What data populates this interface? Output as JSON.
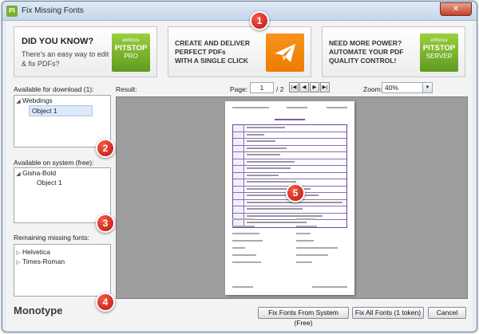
{
  "window": {
    "title": "Fix Missing Fonts",
    "app_icon_glyph": "PI",
    "close_glyph": "✕"
  },
  "banners": [
    {
      "headline": "DID YOU KNOW?",
      "text": "There's an easy way to edit & fix PDFs?",
      "logo": {
        "small": "enfocus",
        "big": "PITSTOP",
        "tag": "PRO"
      }
    },
    {
      "text_lines": [
        "CREATE AND DELIVER",
        "PERFECT PDFs",
        "WITH A SINGLE CLICK"
      ],
      "icon": "send-icon"
    },
    {
      "text_lines": [
        "NEED MORE POWER?",
        "AUTOMATE YOUR PDF",
        "QUALITY CONTROL!"
      ],
      "logo": {
        "small": "enfocus",
        "big": "PITSTOP",
        "tag": "SERVER"
      }
    }
  ],
  "markers": [
    "1",
    "2",
    "3",
    "4",
    "5"
  ],
  "download": {
    "label": "Available for download (1):",
    "font": "Webdings",
    "object": "Object 1"
  },
  "system": {
    "label": "Available on system (free):",
    "font": "Gisha-Bold",
    "object": "Object 1"
  },
  "missing": {
    "label": "Remaining missing fonts:",
    "fonts": [
      "Helvetica",
      "Times-Roman"
    ]
  },
  "result": {
    "label": "Result:"
  },
  "pager": {
    "label": "Page:",
    "current": "1",
    "total": "/ 2",
    "first": "|◀",
    "prev": "◀",
    "next": "▶",
    "last": "▶|"
  },
  "zoom": {
    "label": "Zoom:",
    "value": "40%",
    "arrow": "▼"
  },
  "brand": "Monotype",
  "buttons": {
    "fix_system": "Fix Fonts From System (Free)",
    "fix_all": "Fix All Fonts (1 token)",
    "cancel": "Cancel"
  },
  "colors": {
    "accent_green": "#7bb02c",
    "accent_orange": "#f7941d",
    "marker_red": "#c2150d"
  }
}
